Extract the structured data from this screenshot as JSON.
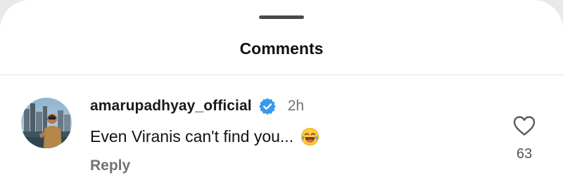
{
  "sheet": {
    "title": "Comments"
  },
  "comment": {
    "username": "amarupadhyay_official",
    "verified": true,
    "timestamp": "2h",
    "text": "Even Viranis can't find you...",
    "emoji": "face-with-tears-of-joy",
    "reply_label": "Reply",
    "like_count": "63"
  },
  "colors": {
    "verified_badge": "#3897f0",
    "secondary_text": "#737373",
    "primary_text": "#111111"
  },
  "icons": {
    "like": "heart-outline-icon",
    "verified": "verified-badge-icon",
    "emoji": "laughing-emoji-icon"
  }
}
